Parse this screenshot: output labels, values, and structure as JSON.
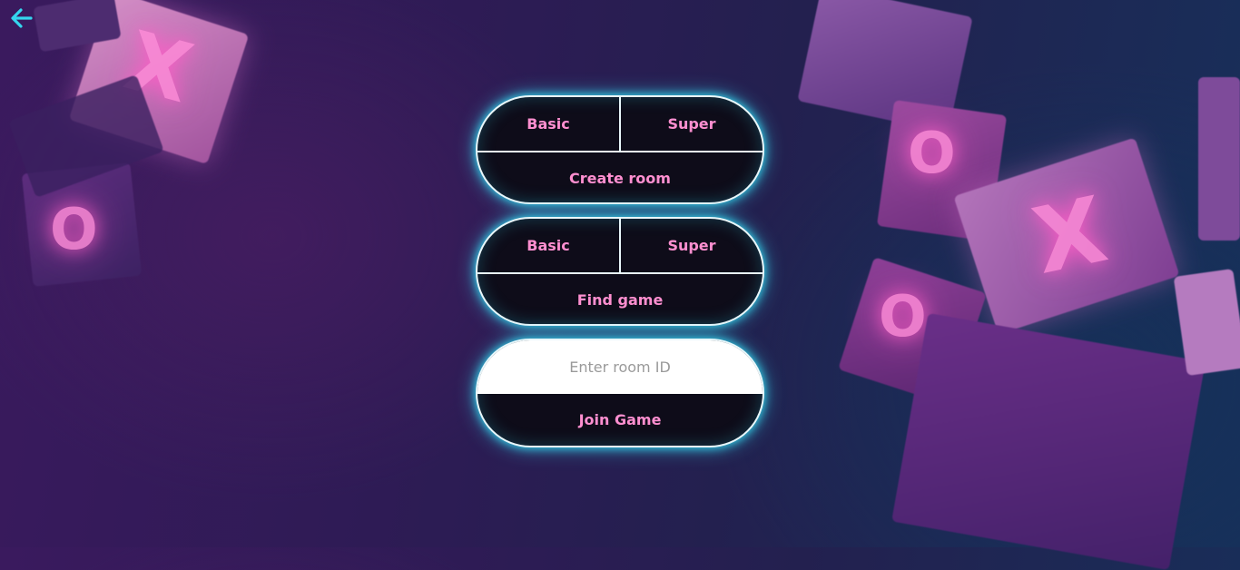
{
  "nav": {
    "back_icon": "arrow-left-icon",
    "back_color": "#34d6ee"
  },
  "create_panel": {
    "basic_label": "Basic",
    "super_label": "Super",
    "action_label": "Create room"
  },
  "find_panel": {
    "basic_label": "Basic",
    "super_label": "Super",
    "action_label": "Find game"
  },
  "join_panel": {
    "room_id_placeholder": "Enter room ID",
    "action_label": "Join Game"
  },
  "background": {
    "glyph_x": "X",
    "glyph_o": "O"
  },
  "colors": {
    "accent": "#34d6ee",
    "label": "#ff8fd0",
    "panel_bg": "#0e0c19"
  }
}
